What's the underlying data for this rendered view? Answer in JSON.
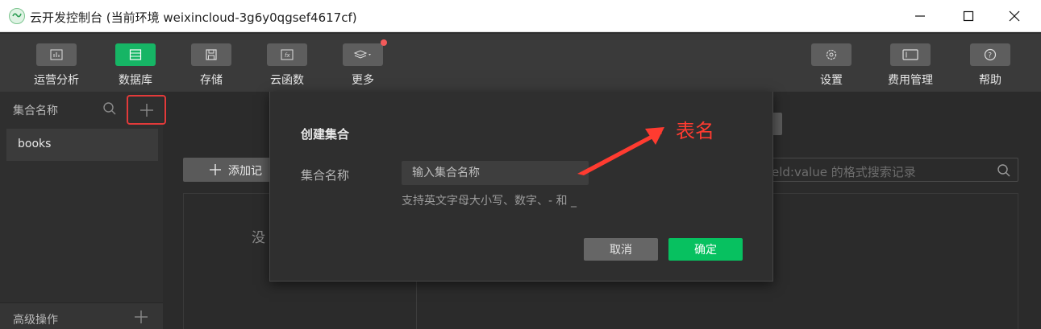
{
  "titlebar": {
    "title": "云开发控制台 (当前环境 weixincloud-3g6y0qgsef4617cf)"
  },
  "toolbar": {
    "items": [
      {
        "label": "运营分析",
        "icon": "bar-chart-icon"
      },
      {
        "label": "数据库",
        "icon": "database-icon",
        "active": true
      },
      {
        "label": "存储",
        "icon": "floppy-icon"
      },
      {
        "label": "云函数",
        "icon": "function-icon"
      },
      {
        "label": "更多",
        "icon": "layers-icon",
        "badge": true
      },
      {
        "label": "设置",
        "icon": "gear-icon"
      },
      {
        "label": "费用管理",
        "icon": "billing-icon"
      },
      {
        "label": "帮助",
        "icon": "help-icon"
      }
    ]
  },
  "sidebar": {
    "title": "集合名称",
    "collections": [
      "books"
    ],
    "footer": "高级操作"
  },
  "main": {
    "add_record": "添加记",
    "search_placeholder": "eld:value 的格式搜索记录",
    "empty": "没"
  },
  "dialog": {
    "title": "创建集合",
    "field_label": "集合名称",
    "input_placeholder": "输入集合名称",
    "hint": "支持英文字母大小写、数字、- 和 _",
    "cancel": "取消",
    "confirm": "确定"
  },
  "annotation": {
    "text": "表名",
    "color": "#ff3b30"
  },
  "colors": {
    "accent": "#07c160",
    "highlight": "#e33a3a"
  }
}
